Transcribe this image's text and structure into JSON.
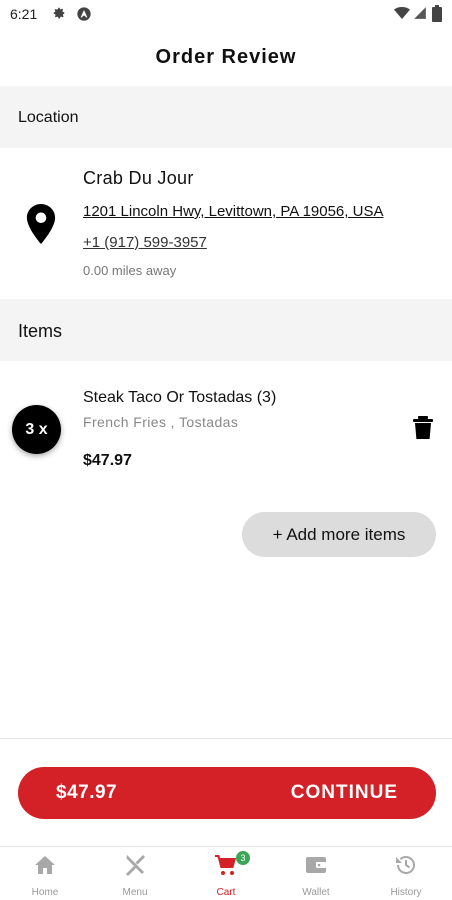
{
  "status_bar": {
    "time": "6:21"
  },
  "header": {
    "title": "Order Review"
  },
  "location_section": {
    "title": "Location",
    "name": "Crab Du Jour",
    "address": "1201 Lincoln Hwy, Levittown, PA 19056, USA",
    "phone": "+1 (917) 599-3957",
    "distance": "0.00 miles away"
  },
  "items_section": {
    "title": "Items",
    "items": [
      {
        "quantity": "3 x",
        "name": "Steak Taco Or Tostadas (3)",
        "options": "French Fries , Tostadas",
        "price": "$47.97"
      }
    ],
    "add_more_label": "+ Add more items"
  },
  "checkout": {
    "total": "$47.97",
    "continue_label": "CONTINUE"
  },
  "bottom_nav": {
    "items": [
      {
        "label": "Home",
        "icon": "home-icon"
      },
      {
        "label": "Menu",
        "icon": "menu-icon"
      },
      {
        "label": "Cart",
        "icon": "cart-icon",
        "active": true,
        "badge": "3"
      },
      {
        "label": "Wallet",
        "icon": "wallet-icon"
      },
      {
        "label": "History",
        "icon": "history-icon"
      }
    ]
  },
  "colors": {
    "accent": "#d42027",
    "badge": "#3aa655",
    "section_bg": "#f4f4f4",
    "inactive_nav": "#999999"
  }
}
